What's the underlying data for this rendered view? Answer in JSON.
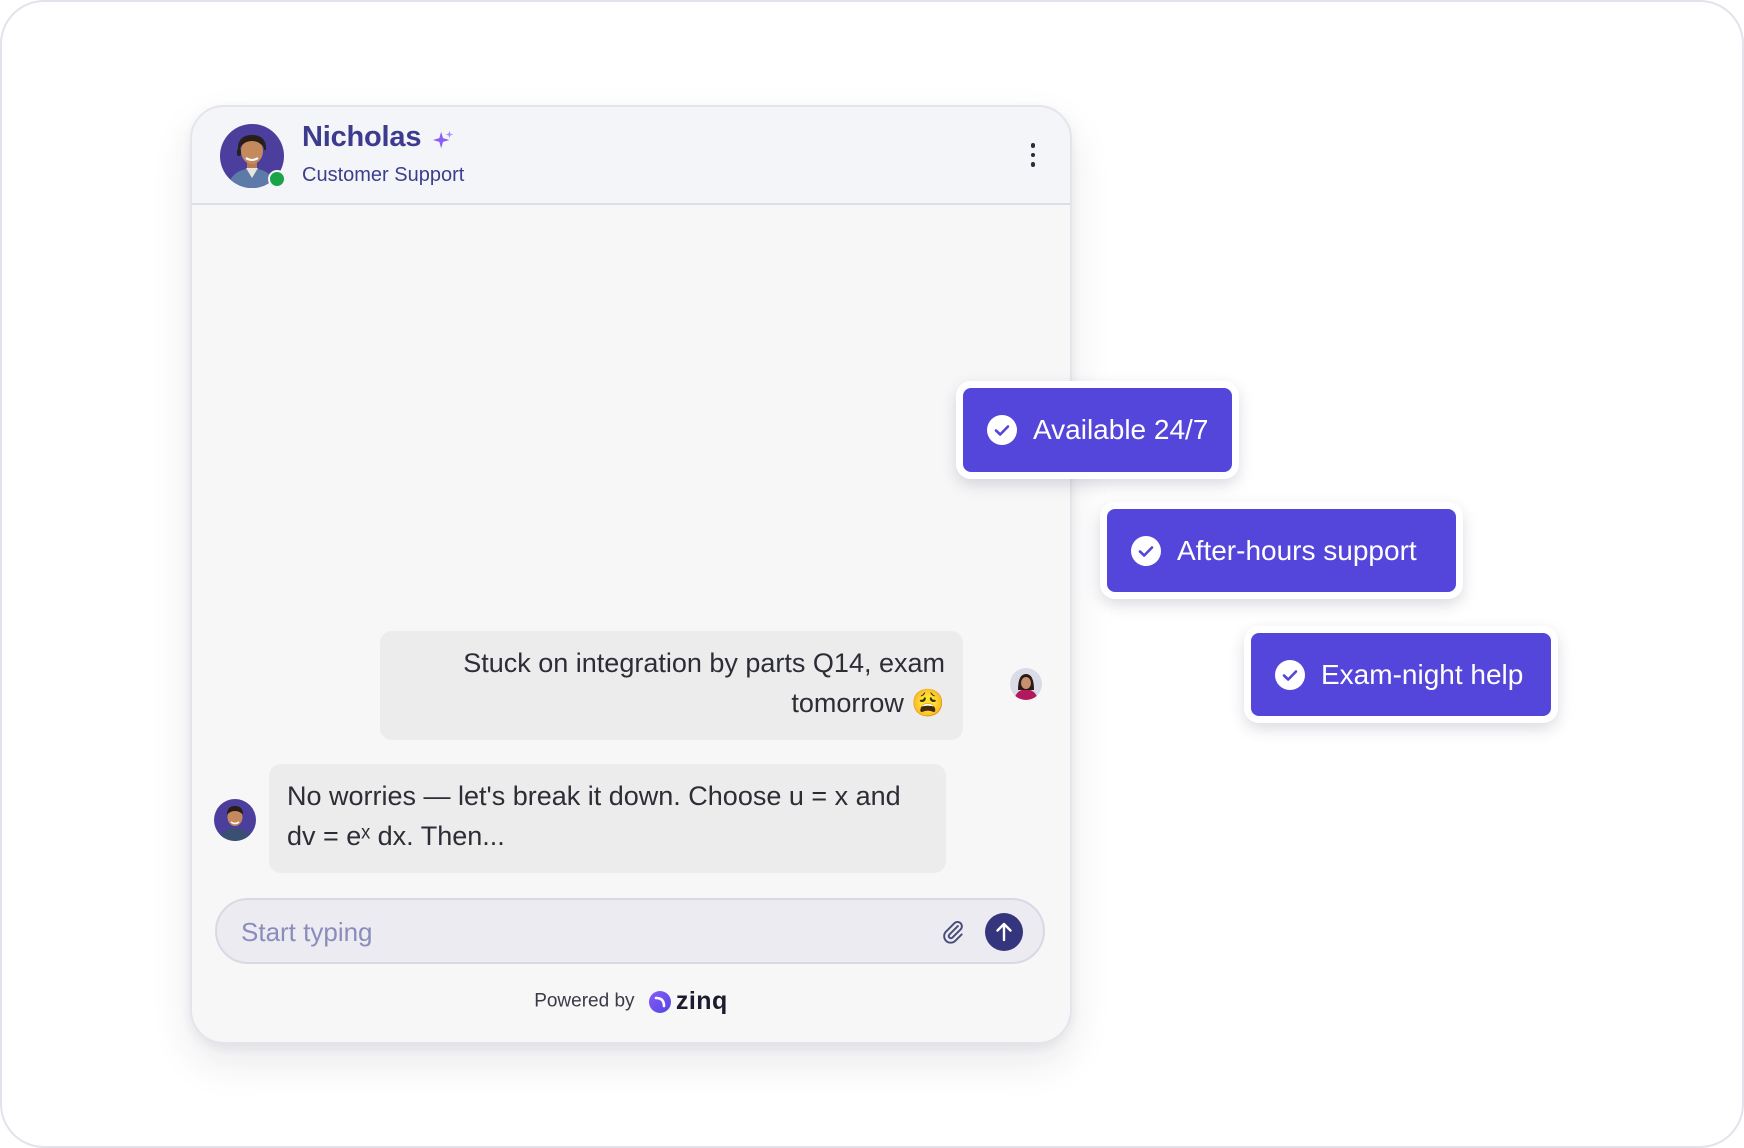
{
  "header": {
    "agent_name": "Nicholas",
    "agent_role": "Customer Support",
    "status": "online"
  },
  "messages": [
    {
      "sender": "user",
      "text": "Stuck on integration by parts Q14, exam tomorrow 😩"
    },
    {
      "sender": "agent",
      "text": "No worries — let's break it down. Choose u = x and dv = eˣ dx. Then..."
    }
  ],
  "composer": {
    "placeholder": "Start typing"
  },
  "footer": {
    "powered_by": "Powered by",
    "brand": "zinq"
  },
  "features": [
    {
      "label": "Available 24/7"
    },
    {
      "label": "After-hours support"
    },
    {
      "label": "Exam-night help"
    }
  ],
  "colors": {
    "accent": "#5546db",
    "header_text": "#3d3b8e",
    "send_button": "#34357d",
    "online": "#1ba34a"
  }
}
